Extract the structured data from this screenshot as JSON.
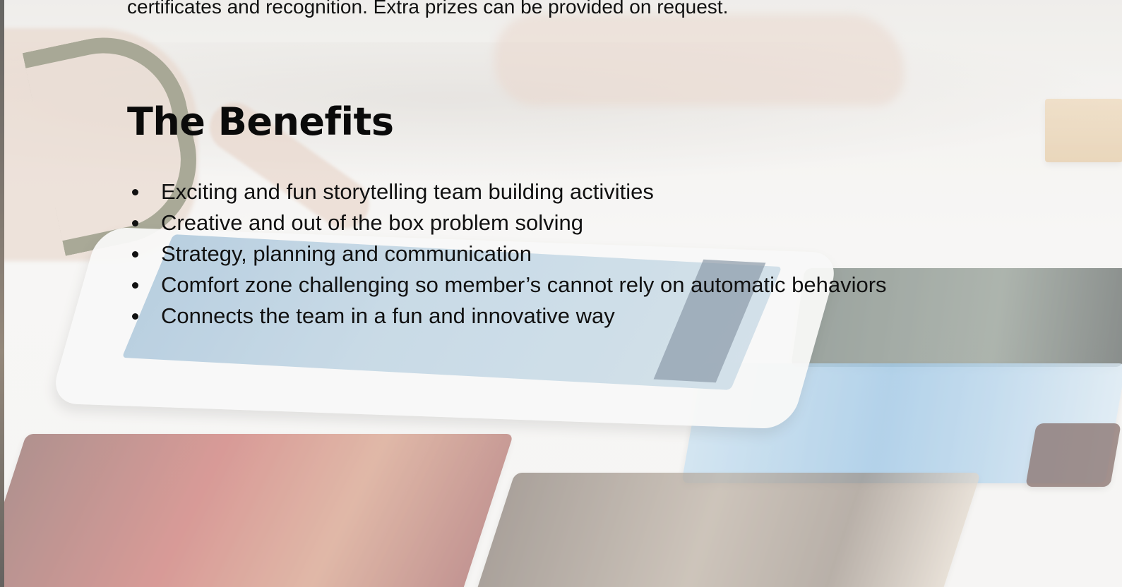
{
  "intro": {
    "tail_text": "certificates and recognition. Extra prizes can be provided on request."
  },
  "benefits": {
    "title": "The Benefits",
    "items": [
      "Exciting and fun storytelling team building activities",
      "Creative and out of the box problem solving",
      "Strategy, planning and communication",
      "Comfort zone challenging so member’s cannot rely on automatic behaviors",
      "Connects the team in a fun and innovative way"
    ]
  },
  "background": {
    "image": "faded-team-tablet-cards-photo"
  }
}
